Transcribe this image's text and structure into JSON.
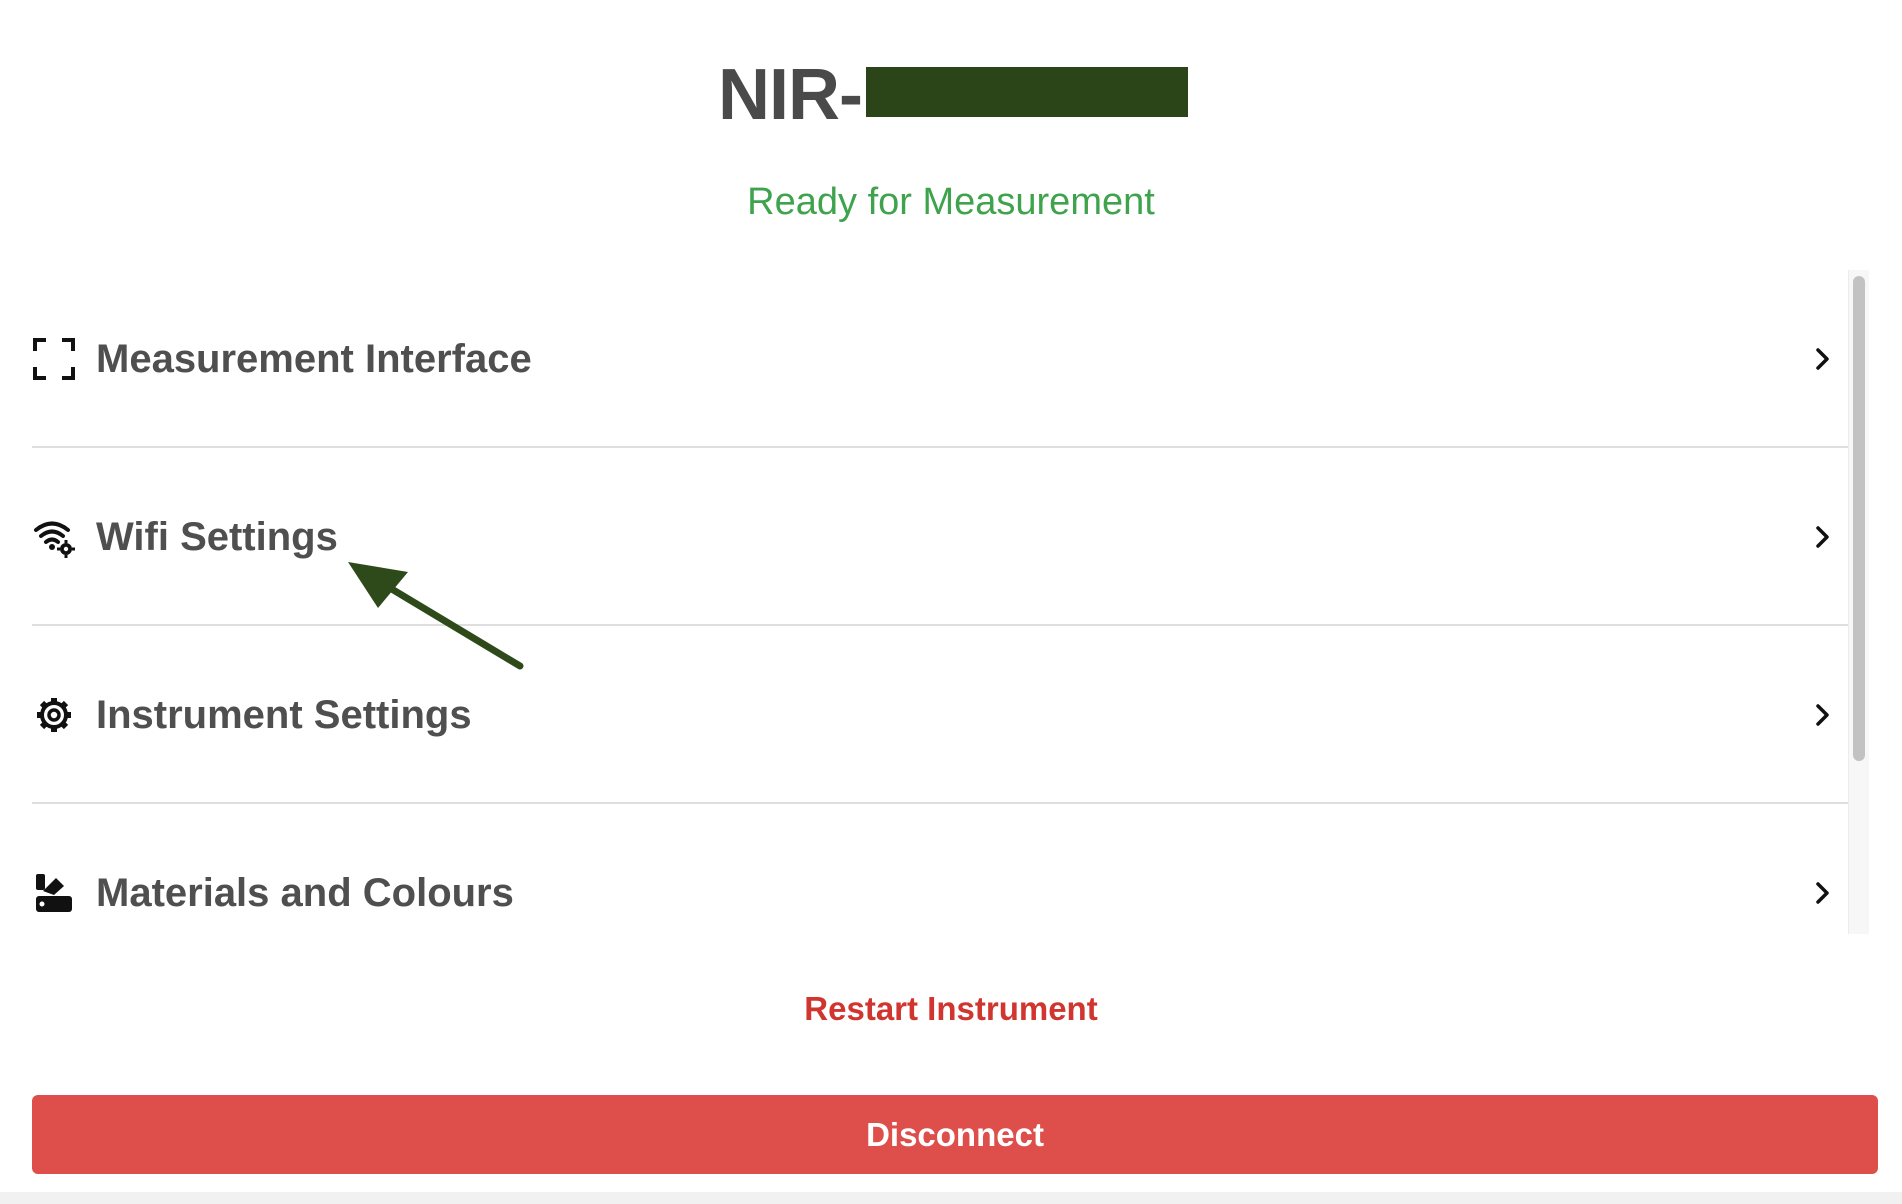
{
  "header": {
    "title_prefix": "NIR-",
    "status": "Ready for Measurement",
    "status_color": "#3fa34d"
  },
  "menu": {
    "items": [
      {
        "label": "Measurement Interface",
        "icon": "scan-frame-icon"
      },
      {
        "label": "Wifi Settings",
        "icon": "wifi-settings-icon"
      },
      {
        "label": "Instrument Settings",
        "icon": "gear-icon"
      },
      {
        "label": "Materials and Colours",
        "icon": "palette-icon"
      }
    ]
  },
  "actions": {
    "restart_label": "Restart Instrument",
    "disconnect_label": "Disconnect",
    "danger_color": "#de4f4c"
  },
  "annotation": {
    "arrow_color": "#2e4a1a",
    "points_to": "Wifi Settings"
  }
}
